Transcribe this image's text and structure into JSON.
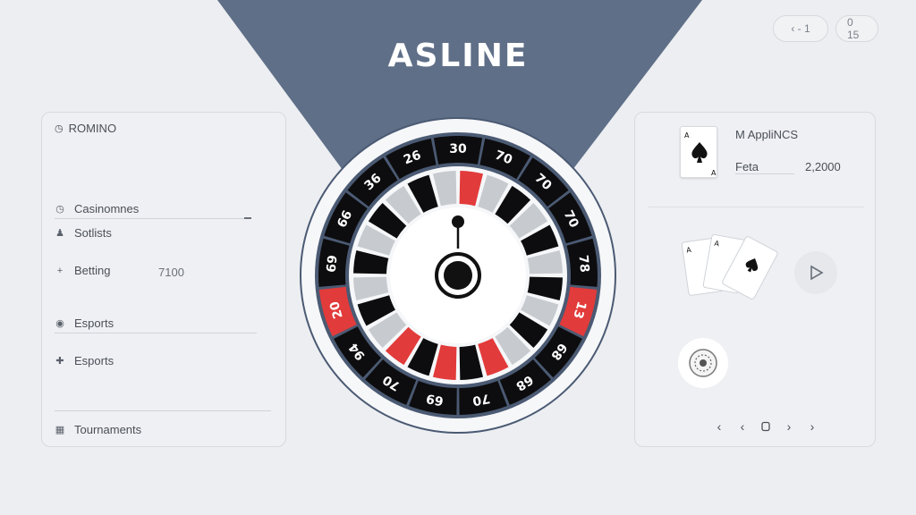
{
  "brand": {
    "title": "ASLINE"
  },
  "top_controls": {
    "pill_a": "‹ - 1",
    "pill_b": "0   15"
  },
  "left_panel": {
    "header": "ROMINO",
    "items": [
      {
        "label": "Casinomnes",
        "icon": "clock-icon"
      },
      {
        "label": "Sotlists",
        "icon": "person-icon"
      },
      {
        "label": "Betting",
        "icon": "plus-icon",
        "value": "7100"
      },
      {
        "label": "Esports",
        "icon": "shield-icon"
      },
      {
        "label": "Esports",
        "icon": "cross-icon"
      },
      {
        "label": "Tournaments",
        "icon": "calendar-icon"
      }
    ]
  },
  "right_panel": {
    "title": "M AppliNCS",
    "field_label": "Fetа",
    "field_value": "2,2000"
  },
  "wheel": {
    "numbers": [
      "30",
      "70",
      "70",
      "70",
      "78",
      "13",
      "68",
      "68",
      "70",
      "69",
      "70",
      "94",
      "20",
      "69",
      "66",
      "36",
      "26"
    ]
  },
  "colors": {
    "navy": "#5a6a84",
    "wheel_outer": "#4b5a73",
    "red": "#e23b3b",
    "black": "#0d0d0f",
    "grey": "#c7cbd0",
    "background": "#eceef1"
  }
}
